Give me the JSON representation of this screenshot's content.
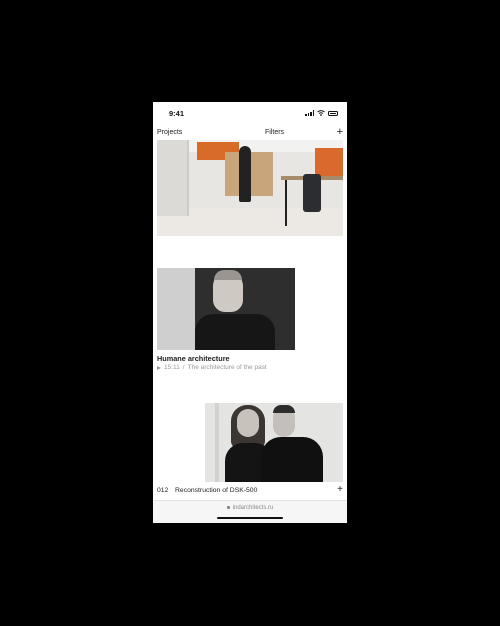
{
  "status_bar": {
    "time": "9:41"
  },
  "nav": {
    "projects_label": "Projects",
    "filters_label": "Filters",
    "add_label": "+"
  },
  "video_item": {
    "title": "Humane architecture",
    "duration": "15:11",
    "separator": "/",
    "subtitle": "The architecture of the past"
  },
  "project_item": {
    "number": "012",
    "title": "Reconstruction of DSK-500",
    "add_label": "+"
  },
  "browser": {
    "url": "indarchitects.ru"
  },
  "icons": [
    "signal-icon",
    "wifi-icon",
    "battery-icon",
    "plus-icon",
    "play-icon",
    "lock-icon"
  ]
}
